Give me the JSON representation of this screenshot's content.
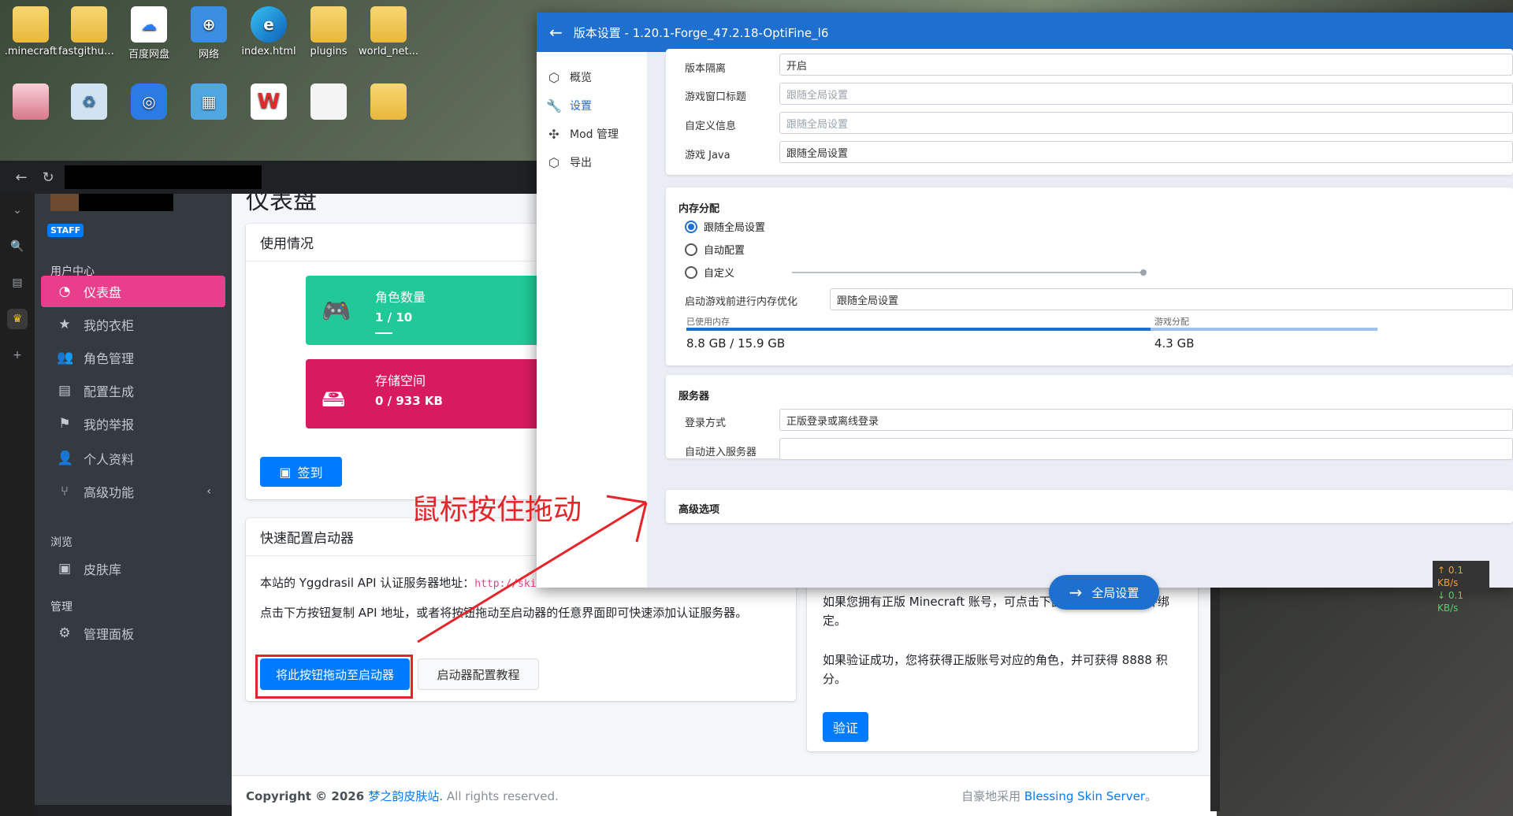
{
  "desktop": {
    "icons": [
      {
        "label": ".minecraft",
        "icon": "folder-icon"
      },
      {
        "label": "fastgithub_...",
        "icon": "folder-icon"
      },
      {
        "label": "百度网盘",
        "icon": "baidu-netdisk-icon"
      },
      {
        "label": "网络",
        "icon": "network-icon"
      },
      {
        "label": "index.html",
        "icon": "edge-icon"
      },
      {
        "label": "plugins",
        "icon": "folder-icon"
      },
      {
        "label": "world_net...",
        "icon": "folder-icon"
      }
    ]
  },
  "launcher": {
    "title": "版本设置 - 1.20.1-Forge_47.2.18-OptiFine_l6",
    "nav": [
      "概览",
      "设置",
      "Mod 管理",
      "导出"
    ],
    "general": {
      "rows": [
        {
          "label": "版本隔离",
          "value": "开启"
        },
        {
          "label": "游戏窗口标题",
          "value": "跟随全局设置"
        },
        {
          "label": "自定义信息",
          "value": "跟随全局设置"
        },
        {
          "label": "游戏 Java",
          "value": "跟随全局设置"
        }
      ]
    },
    "memory": {
      "title": "内存分配",
      "options": [
        "跟随全局设置",
        "自动配置",
        "自定义"
      ],
      "selected": 0,
      "optimize_label": "启动游戏前进行内存优化",
      "optimize_value": "跟随全局设置",
      "used_label": "已使用内存",
      "used_value": "8.8 GB / 15.9 GB",
      "alloc_label": "游戏分配",
      "alloc_value": "4.3 GB",
      "used_fraction": 0.553,
      "alloc_fraction": 0.27
    },
    "server": {
      "title": "服务器",
      "login_label": "登录方式",
      "login_value": "正版登录或离线登录",
      "auto_join_label": "自动进入服务器",
      "auto_join_value": ""
    },
    "advanced_title": "高级选项",
    "global_button": "全局设置"
  },
  "site": {
    "staff_badge": "STAFF",
    "sections": {
      "user_center": "用户中心",
      "browse": "浏览",
      "manage": "管理"
    },
    "nav": {
      "dashboard": "仪表盘",
      "closet": "我的衣柜",
      "players": "角色管理",
      "config": "配置生成",
      "reports": "我的举报",
      "profile": "个人资料",
      "advanced": "高级功能",
      "skinlib": "皮肤库",
      "admin": "管理面板"
    },
    "page_title": "仪表盘",
    "usage": {
      "title": "使用情况",
      "players_label": "角色数量",
      "players_value": "1 / 10",
      "storage_label": "存储空间",
      "storage_value": "0 / 933 KB"
    },
    "sign_button": "签到",
    "quick": {
      "title": "快速配置启动器",
      "line1_prefix": "本站的 Yggdrasil API 认证服务器地址：",
      "line1_url": "http://ski",
      "line2": "点击下方按钮复制 API 地址，或者将按钮拖动至启动器的任意界面即可快速添加认证服务器。",
      "drag_button": "将此按钮拖动至启动器",
      "tutorial_button": "启动器配置教程"
    },
    "verify": {
      "text1": "如果您拥有正版 Minecraft 账号，可点击下面的按钮进行验证并绑定。",
      "text2": "如果验证成功，您将获得正版账号对应的角色，并可获得 8888 积分。",
      "button": "验证"
    },
    "footer": {
      "copyright_prefix": "Copyright © 2026 ",
      "site_name": "梦之韵皮肤站.",
      "rights": " All rights reserved.",
      "powered_prefix": "自豪地采用 ",
      "powered_link": "Blessing Skin Server",
      "powered_suffix": "。"
    }
  },
  "annotation": {
    "text": "鼠标按住拖动"
  },
  "speed": {
    "up": "↑ 0.1 KB/s",
    "down": "↓ 0.1 KB/s"
  },
  "colors": {
    "launcher_blue": "#1e6fce",
    "active_pink": "#e83e8c",
    "teal": "#20c997",
    "crimson": "#d81b60",
    "annotation_red": "#e5252a"
  }
}
